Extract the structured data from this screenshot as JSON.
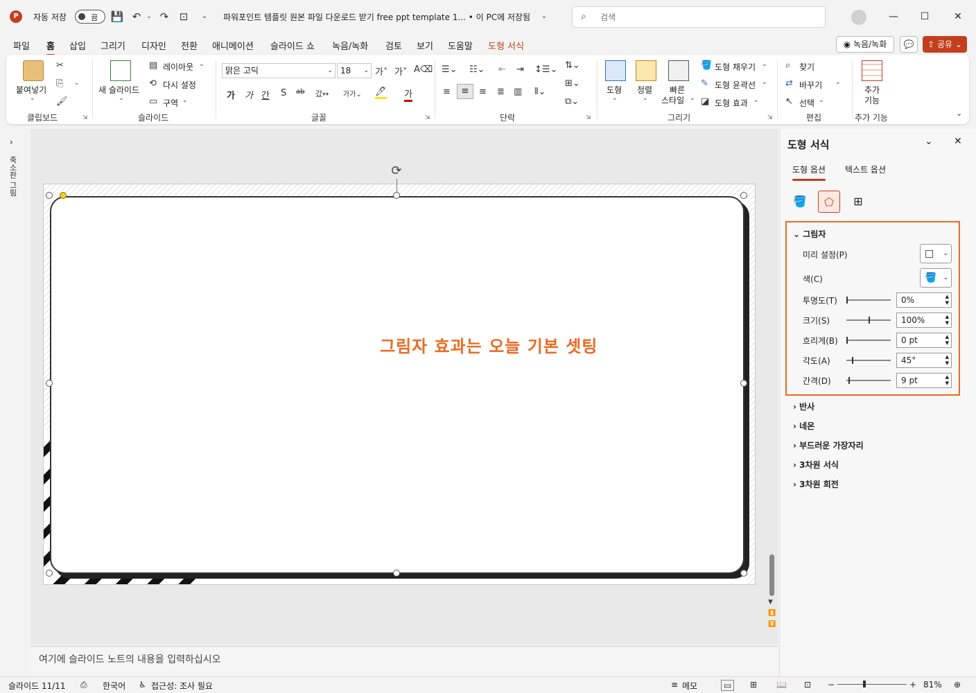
{
  "titlebar": {
    "autosave_label": "자동 저장",
    "autosave_state": "끔",
    "document_title": "파워포인트 템플릿 원본 파일 다운로드 받기 free ppt template 1... • 이 PC에 저장됨",
    "search_placeholder": "검색",
    "brand_color": "#c43e1c"
  },
  "tabs": [
    {
      "label": "파일"
    },
    {
      "label": "홈"
    },
    {
      "label": "삽입"
    },
    {
      "label": "그리기"
    },
    {
      "label": "디자인"
    },
    {
      "label": "전환"
    },
    {
      "label": "애니메이션"
    },
    {
      "label": "슬라이드 쇼"
    },
    {
      "label": "녹음/녹화"
    },
    {
      "label": "검토"
    },
    {
      "label": "보기"
    },
    {
      "label": "도움말"
    },
    {
      "label": "도형 서식"
    }
  ],
  "header_buttons": {
    "record": "녹음/녹화",
    "share": "공유"
  },
  "ribbon": {
    "clipboard": {
      "paste": "붙여넣기",
      "label": "클립보드"
    },
    "slides": {
      "new_slide": "새 슬라이드",
      "layout": "레이아웃",
      "reset": "다시 설정",
      "section": "구역",
      "label": "슬라이드"
    },
    "font": {
      "family": "맑은 고딕",
      "size": "18",
      "label": "글꼴"
    },
    "paragraph": {
      "label": "단락"
    },
    "drawing": {
      "shapes": "도형",
      "arrange": "정렬",
      "quick_style_1": "빠른",
      "quick_style_2": "스타일",
      "fill": "도형 채우기",
      "outline": "도형 윤곽선",
      "effects": "도형 효과",
      "label": "그리기"
    },
    "editing": {
      "find": "찾기",
      "replace": "바꾸기",
      "select": "선택",
      "label": "편집"
    },
    "addins": {
      "line1": "추가",
      "line2": "기능",
      "label": "추가 기능"
    }
  },
  "thumb_pane": {
    "label": "축소판 그림"
  },
  "slide": {
    "text": "그림자 효과는 오늘 기본 셋팅",
    "text_color": "#ed6a21"
  },
  "notes": {
    "placeholder": "여기에 슬라이드 노트의 내용을 입력하십시오"
  },
  "pane": {
    "title": "도형 서식",
    "tabs": [
      "도형 옵션",
      "텍스트 옵션"
    ],
    "shadow": {
      "header": "그림자",
      "preset_label": "미리 설정(P)",
      "color_label": "색(C)",
      "props": [
        {
          "label": "투명도(T)",
          "value": "0%",
          "level": 0.0
        },
        {
          "label": "크기(S)",
          "value": "100%",
          "level": 0.5
        },
        {
          "label": "흐리게(B)",
          "value": "0 pt",
          "level": 0.0
        },
        {
          "label": "각도(A)",
          "value": "45°",
          "level": 0.125
        },
        {
          "label": "간격(D)",
          "value": "9 pt",
          "level": 0.045
        }
      ]
    },
    "sections": [
      "반사",
      "네온",
      "부드러운 가장자리",
      "3차원 서식",
      "3차원 회전"
    ]
  },
  "status": {
    "slide_num": "슬라이드 11/11",
    "language": "한국어",
    "accessibility": "접근성: 조사 필요",
    "notes_btn": "메모",
    "zoom": "81%",
    "zoom_level": 0.81
  }
}
